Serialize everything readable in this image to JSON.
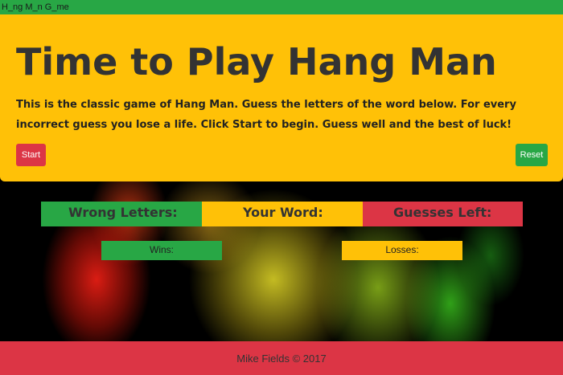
{
  "window": {
    "title": "H_ng M_n G_me"
  },
  "jumbotron": {
    "title": "Time to Play Hang Man",
    "description": "This is the classic game of Hang Man. Guess the letters of the word below. For every incorrect guess you lose a life. Click Start to begin. Guess well and the best of luck!",
    "start_label": "Start",
    "reset_label": "Reset"
  },
  "scoreboard": {
    "wrong_letters_label": "Wrong Letters:",
    "your_word_label": "Your Word:",
    "guesses_left_label": "Guesses Left:",
    "wins_label": "Wins:",
    "losses_label": "Losses:"
  },
  "footer": {
    "text": "Mike Fields © 2017"
  },
  "colors": {
    "green": "#28a745",
    "yellow": "#ffc107",
    "red": "#dc3545"
  }
}
